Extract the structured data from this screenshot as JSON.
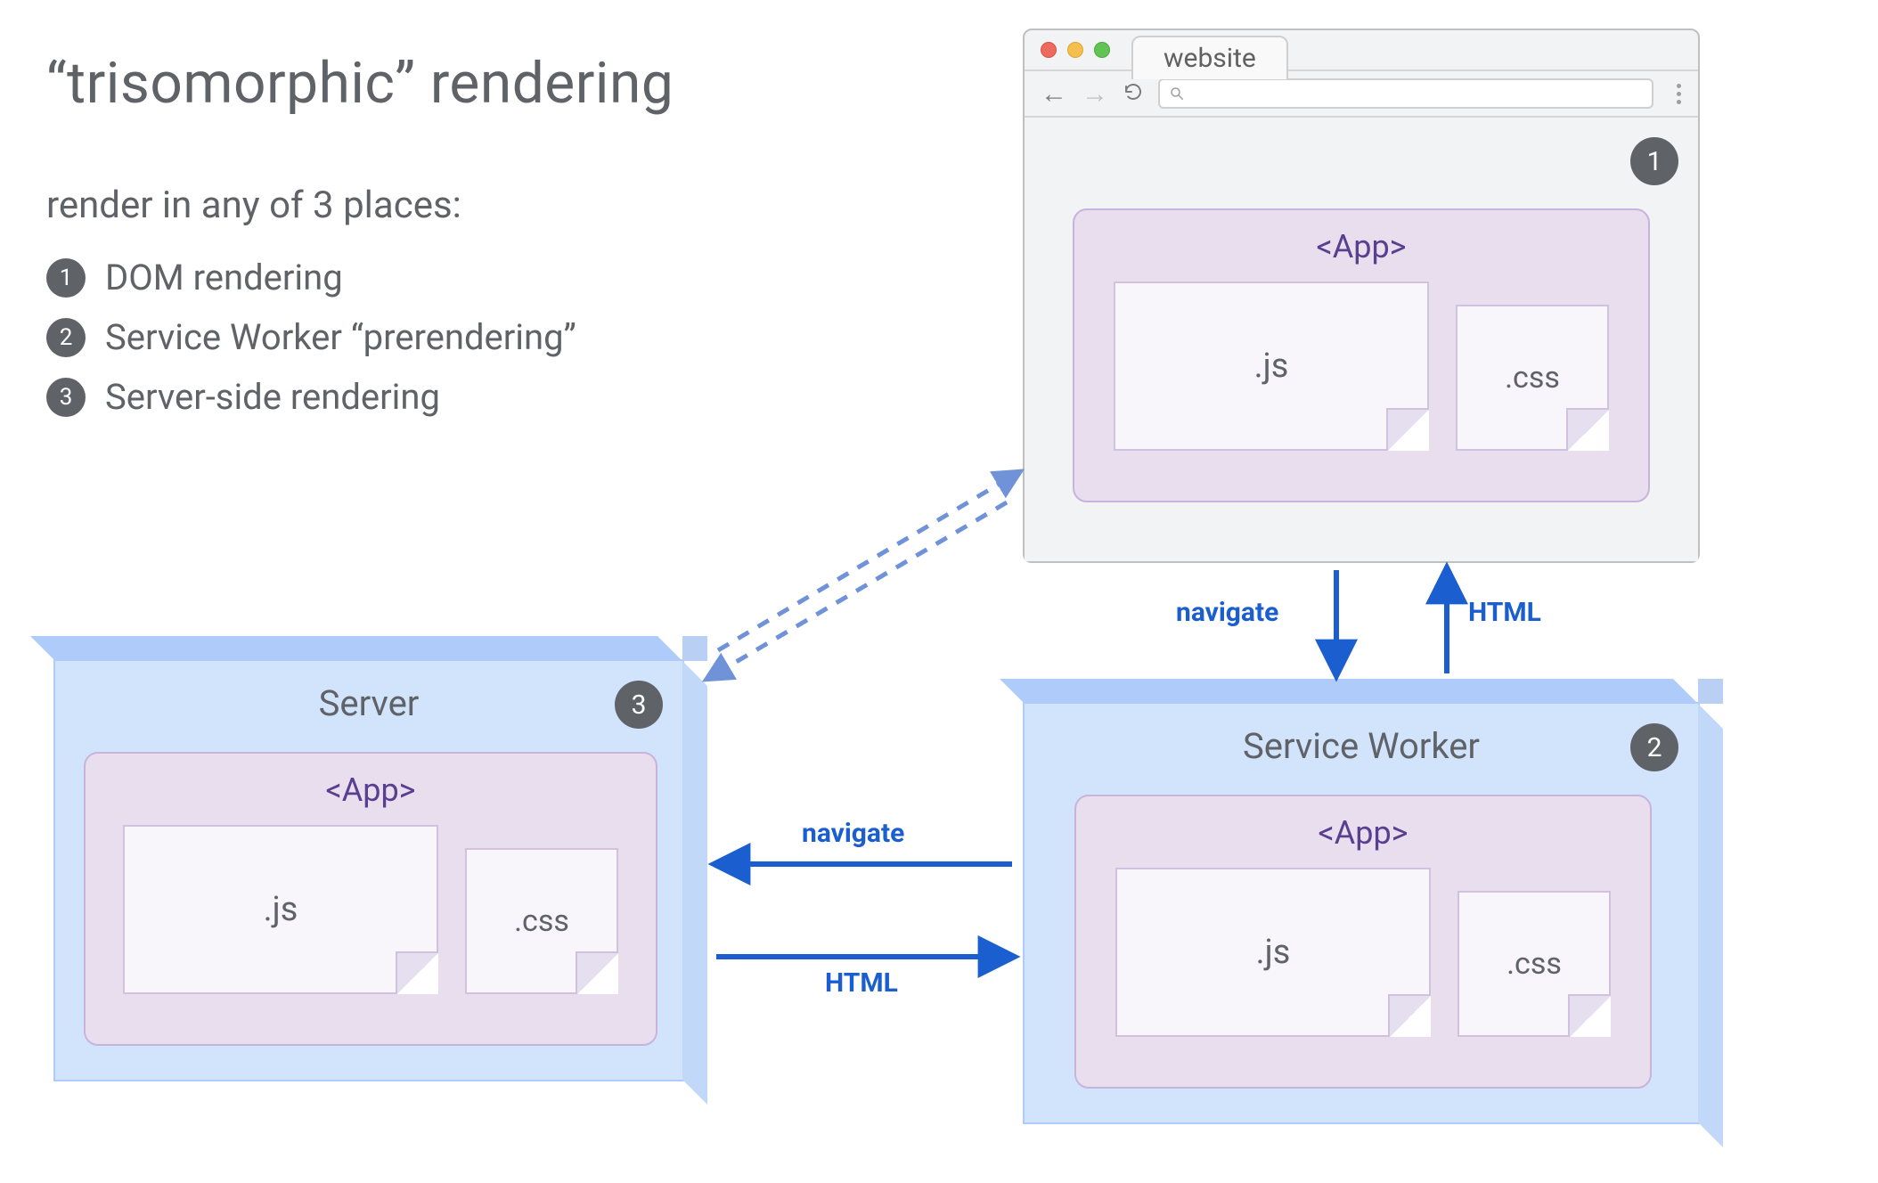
{
  "title": "“trisomorphic” rendering",
  "subtitle": "render in any of 3 places:",
  "list": [
    {
      "n": "1",
      "label": "DOM rendering"
    },
    {
      "n": "2",
      "label": "Service Worker “prerendering”"
    },
    {
      "n": "3",
      "label": "Server-side rendering"
    }
  ],
  "browser": {
    "tab_label": "website",
    "badge": "1",
    "app_label": "<App>",
    "file_js": ".js",
    "file_css": ".css"
  },
  "server": {
    "title": "Server",
    "badge": "3",
    "app_label": "<App>",
    "file_js": ".js",
    "file_css": ".css"
  },
  "worker": {
    "title": "Service Worker",
    "badge": "2",
    "app_label": "<App>",
    "file_js": ".js",
    "file_css": ".css"
  },
  "arrows": {
    "browser_to_worker_down": "navigate",
    "worker_to_browser_up": "HTML",
    "worker_to_server_left": "navigate",
    "server_to_worker_right": "HTML"
  },
  "colors": {
    "text": "#5f6368",
    "badge_bg": "#5f6368",
    "box_face": "#d2e3fc",
    "box_edge": "#aecbfa",
    "app_bg": "#e8deee",
    "app_border": "#c7b4db",
    "app_label": "#5a3e8f",
    "arrow_blue": "#1a5ed0",
    "arrow_dashed": "#6f92d8"
  }
}
